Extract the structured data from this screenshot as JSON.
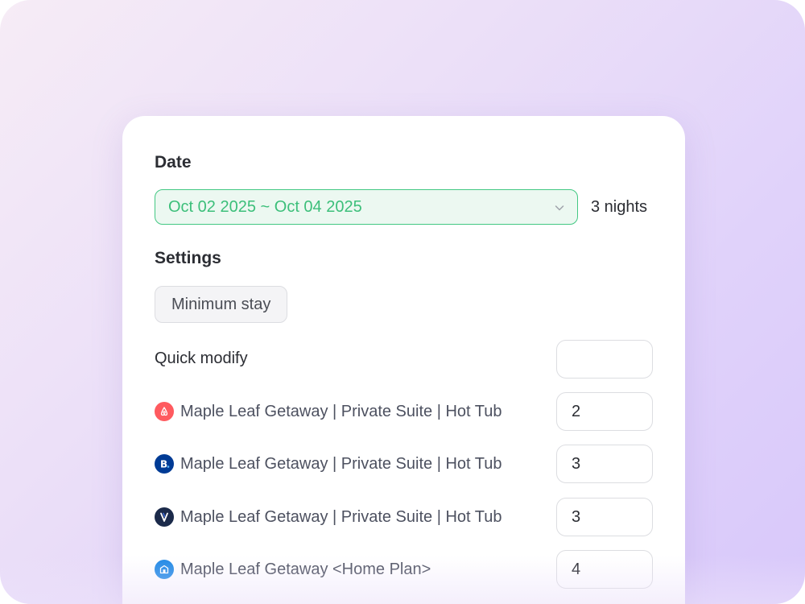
{
  "date_section": {
    "title": "Date",
    "range": "Oct 02 2025 ~ Oct 04 2025",
    "nights": "3 nights"
  },
  "settings_section": {
    "title": "Settings",
    "chip_label": "Minimum stay"
  },
  "quick_modify": {
    "label": "Quick modify",
    "value": ""
  },
  "listings": [
    {
      "icon": "airbnb-logo-icon",
      "name": "Maple Leaf Getaway | Private Suite | Hot Tub",
      "value": "2"
    },
    {
      "icon": "booking-com-logo-icon",
      "name": "Maple Leaf Getaway | Private Suite | Hot Tub",
      "value": "3"
    },
    {
      "icon": "vrbo-logo-icon",
      "name": "Maple Leaf Getaway | Private Suite | Hot Tub",
      "value": "3"
    },
    {
      "icon": "direct-booking-logo-icon",
      "name": "Maple Leaf Getaway <Home Plan>",
      "value": "4"
    }
  ],
  "colors": {
    "accent_green": "#43c883",
    "airbnb_red": "#ff5a5f",
    "booking_blue": "#003b95",
    "vrbo_navy": "#1b2a4a",
    "direct_blue": "#1e88e5"
  }
}
